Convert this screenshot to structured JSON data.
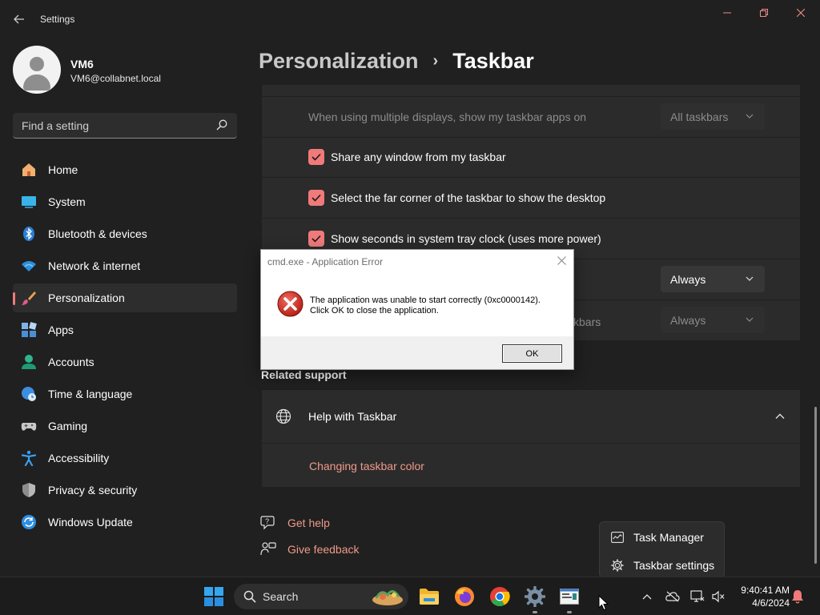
{
  "window": {
    "title": "Settings",
    "back_icon": "back-arrow-icon",
    "controls": [
      "minimize-icon",
      "restore-icon",
      "close-icon"
    ]
  },
  "profile": {
    "name": "VM6",
    "email": "VM6@collabnet.local"
  },
  "search": {
    "placeholder": "Find a setting"
  },
  "nav": {
    "items": [
      {
        "label": "Home",
        "icon": "home-icon"
      },
      {
        "label": "System",
        "icon": "monitor-icon"
      },
      {
        "label": "Bluetooth & devices",
        "icon": "bluetooth-icon"
      },
      {
        "label": "Network & internet",
        "icon": "wifi-icon"
      },
      {
        "label": "Personalization",
        "icon": "brush-icon",
        "active": true
      },
      {
        "label": "Apps",
        "icon": "apps-icon"
      },
      {
        "label": "Accounts",
        "icon": "person-icon"
      },
      {
        "label": "Time & language",
        "icon": "clock-globe-icon"
      },
      {
        "label": "Gaming",
        "icon": "gamepad-icon"
      },
      {
        "label": "Accessibility",
        "icon": "accessibility-icon"
      },
      {
        "label": "Privacy & security",
        "icon": "shield-icon"
      },
      {
        "label": "Windows Update",
        "icon": "update-icon"
      }
    ]
  },
  "breadcrumb": {
    "parent": "Personalization",
    "separator": "›",
    "current": "Taskbar"
  },
  "settings": {
    "multi_display_label": "When using multiple displays, show my taskbar apps on",
    "multi_display_value": "All taskbars",
    "share_window": "Share any window from my taskbar",
    "far_corner": "Select the far corner of the taskbar to show the desktop",
    "show_seconds": "Show seconds in system tray clock (uses more power)",
    "combine_value": "Always",
    "other_taskbars_label": "kbars",
    "other_taskbars_value": "Always"
  },
  "related": {
    "heading": "Related support",
    "help_title": "Help with Taskbar",
    "help_link": "Changing taskbar color"
  },
  "footer_links": {
    "get_help": "Get help",
    "give_feedback": "Give feedback"
  },
  "dialog": {
    "title": "cmd.exe - Application Error",
    "message_line1": "The application was unable to start correctly (0xc0000142).",
    "message_line2": "Click OK to close the application.",
    "ok_label": "OK",
    "icon": "error-icon"
  },
  "context_menu": {
    "items": [
      {
        "label": "Task Manager",
        "icon": "task-manager-icon"
      },
      {
        "label": "Taskbar settings",
        "icon": "gear-icon"
      }
    ]
  },
  "taskbar": {
    "search_label": "Search",
    "clock_time": "9:40:41 AM",
    "clock_date": "4/6/2024"
  },
  "colors": {
    "accent": "#f07a7a",
    "link": "#f09a8a",
    "background": "#202020",
    "card": "#2b2b2b",
    "error_red": "#c42b1c"
  }
}
